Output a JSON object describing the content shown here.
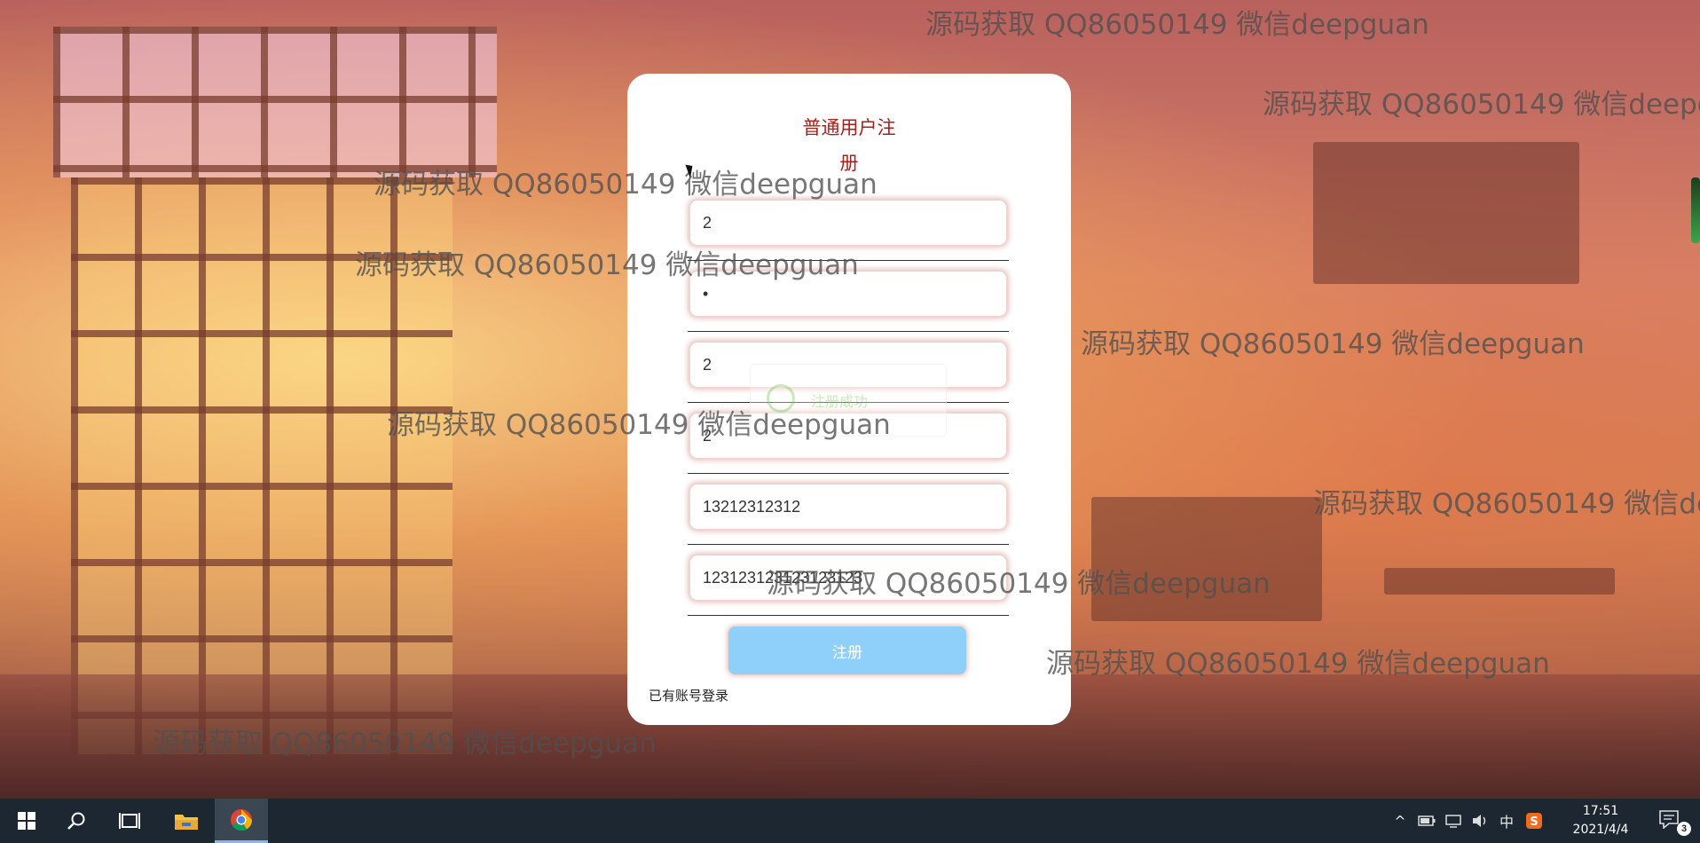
{
  "form": {
    "title_line1": "普通用户注",
    "title_line2": "册",
    "fields": [
      {
        "value": "2",
        "type": "text"
      },
      {
        "value": "2",
        "type": "password"
      },
      {
        "value": "2",
        "type": "text"
      },
      {
        "value": "2",
        "type": "text"
      },
      {
        "value": "13212312312",
        "type": "text"
      },
      {
        "value": "123123123123123123",
        "type": "text"
      }
    ],
    "register_label": "注册",
    "login_link": "已有账号登录"
  },
  "toast": {
    "message": "注册成功"
  },
  "watermark": {
    "text": "源码获取 QQ86050149 微信deepguan"
  },
  "taskbar": {
    "time": "17:51",
    "date": "2021/4/4",
    "ime": "中",
    "notification_count": "3",
    "icons": [
      "windows-start-icon",
      "search-icon",
      "task-view-icon",
      "file-explorer-icon",
      "chrome-icon"
    ]
  },
  "colors": {
    "title": "#a8201c",
    "button": "#8fd0fb",
    "taskbar": "#1c2731"
  }
}
